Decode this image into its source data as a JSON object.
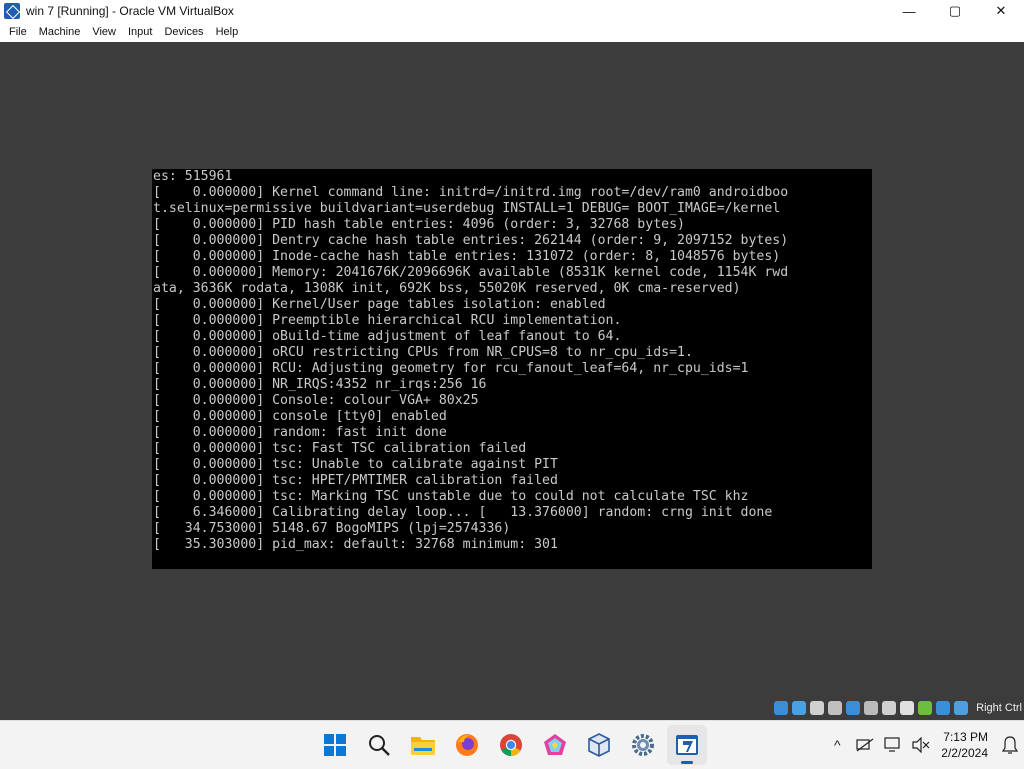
{
  "window": {
    "title": "win 7 [Running] - Oracle VM VirtualBox",
    "minimize": "—",
    "maximize": "▢",
    "close": "✕"
  },
  "menu": [
    "File",
    "Machine",
    "View",
    "Input",
    "Devices",
    "Help"
  ],
  "console_lines": [
    "es: 515961",
    "[    0.000000] Kernel command line: initrd=/initrd.img root=/dev/ram0 androidboo",
    "t.selinux=permissive buildvariant=userdebug INSTALL=1 DEBUG= BOOT_IMAGE=/kernel",
    "[    0.000000] PID hash table entries: 4096 (order: 3, 32768 bytes)",
    "[    0.000000] Dentry cache hash table entries: 262144 (order: 9, 2097152 bytes)",
    "[    0.000000] Inode-cache hash table entries: 131072 (order: 8, 1048576 bytes)",
    "[    0.000000] Memory: 2041676K/2096696K available (8531K kernel code, 1154K rwd",
    "ata, 3636K rodata, 1308K init, 692K bss, 55020K reserved, 0K cma-reserved)",
    "[    0.000000] Kernel/User page tables isolation: enabled",
    "[    0.000000] Preemptible hierarchical RCU implementation.",
    "[    0.000000] oBuild-time adjustment of leaf fanout to 64.",
    "[    0.000000] oRCU restricting CPUs from NR_CPUS=8 to nr_cpu_ids=1.",
    "[    0.000000] RCU: Adjusting geometry for rcu_fanout_leaf=64, nr_cpu_ids=1",
    "[    0.000000] NR_IRQS:4352 nr_irqs:256 16",
    "[    0.000000] Console: colour VGA+ 80x25",
    "[    0.000000] console [tty0] enabled",
    "[    0.000000] random: fast init done",
    "[    0.000000] tsc: Fast TSC calibration failed",
    "[    0.000000] tsc: Unable to calibrate against PIT",
    "[    0.000000] tsc: HPET/PMTIMER calibration failed",
    "[    0.000000] tsc: Marking TSC unstable due to could not calculate TSC khz",
    "[    6.346000] Calibrating delay loop... [   13.376000] random: crng init done",
    "[   34.753000] 5148.67 BogoMIPS (lpj=2574336)",
    "[   35.303000] pid_max: default: 32768 minimum: 301"
  ],
  "statusbar": {
    "host_key": "Right Ctrl",
    "icons": [
      "optical-drive-icon",
      "audio-icon",
      "network-icon",
      "usb-icon",
      "shared-folders-icon",
      "display-icon",
      "video-capture-icon",
      "virtualization-icon",
      "cpu-icon",
      "mouse-integration-icon",
      "keyboard-icon"
    ],
    "icon_colors": [
      "#3a8fd8",
      "#4aa0e0",
      "#d0d0d0",
      "#c0c0c0",
      "#3a8fd8",
      "#bbbbbb",
      "#d0d0d0",
      "#e0e0e0",
      "#6cbf3c",
      "#3a8fd8",
      "#4aa0e0"
    ]
  },
  "taskbar": {
    "apps": [
      "start-icon",
      "search-icon",
      "file-explorer-icon",
      "firefox-icon",
      "chrome-icon",
      "app-icon",
      "virtualbox-icon",
      "settings-icon",
      "vm-window-icon"
    ],
    "tray_chevron": "^",
    "time": "7:13 PM",
    "date": "2/2/2024"
  }
}
